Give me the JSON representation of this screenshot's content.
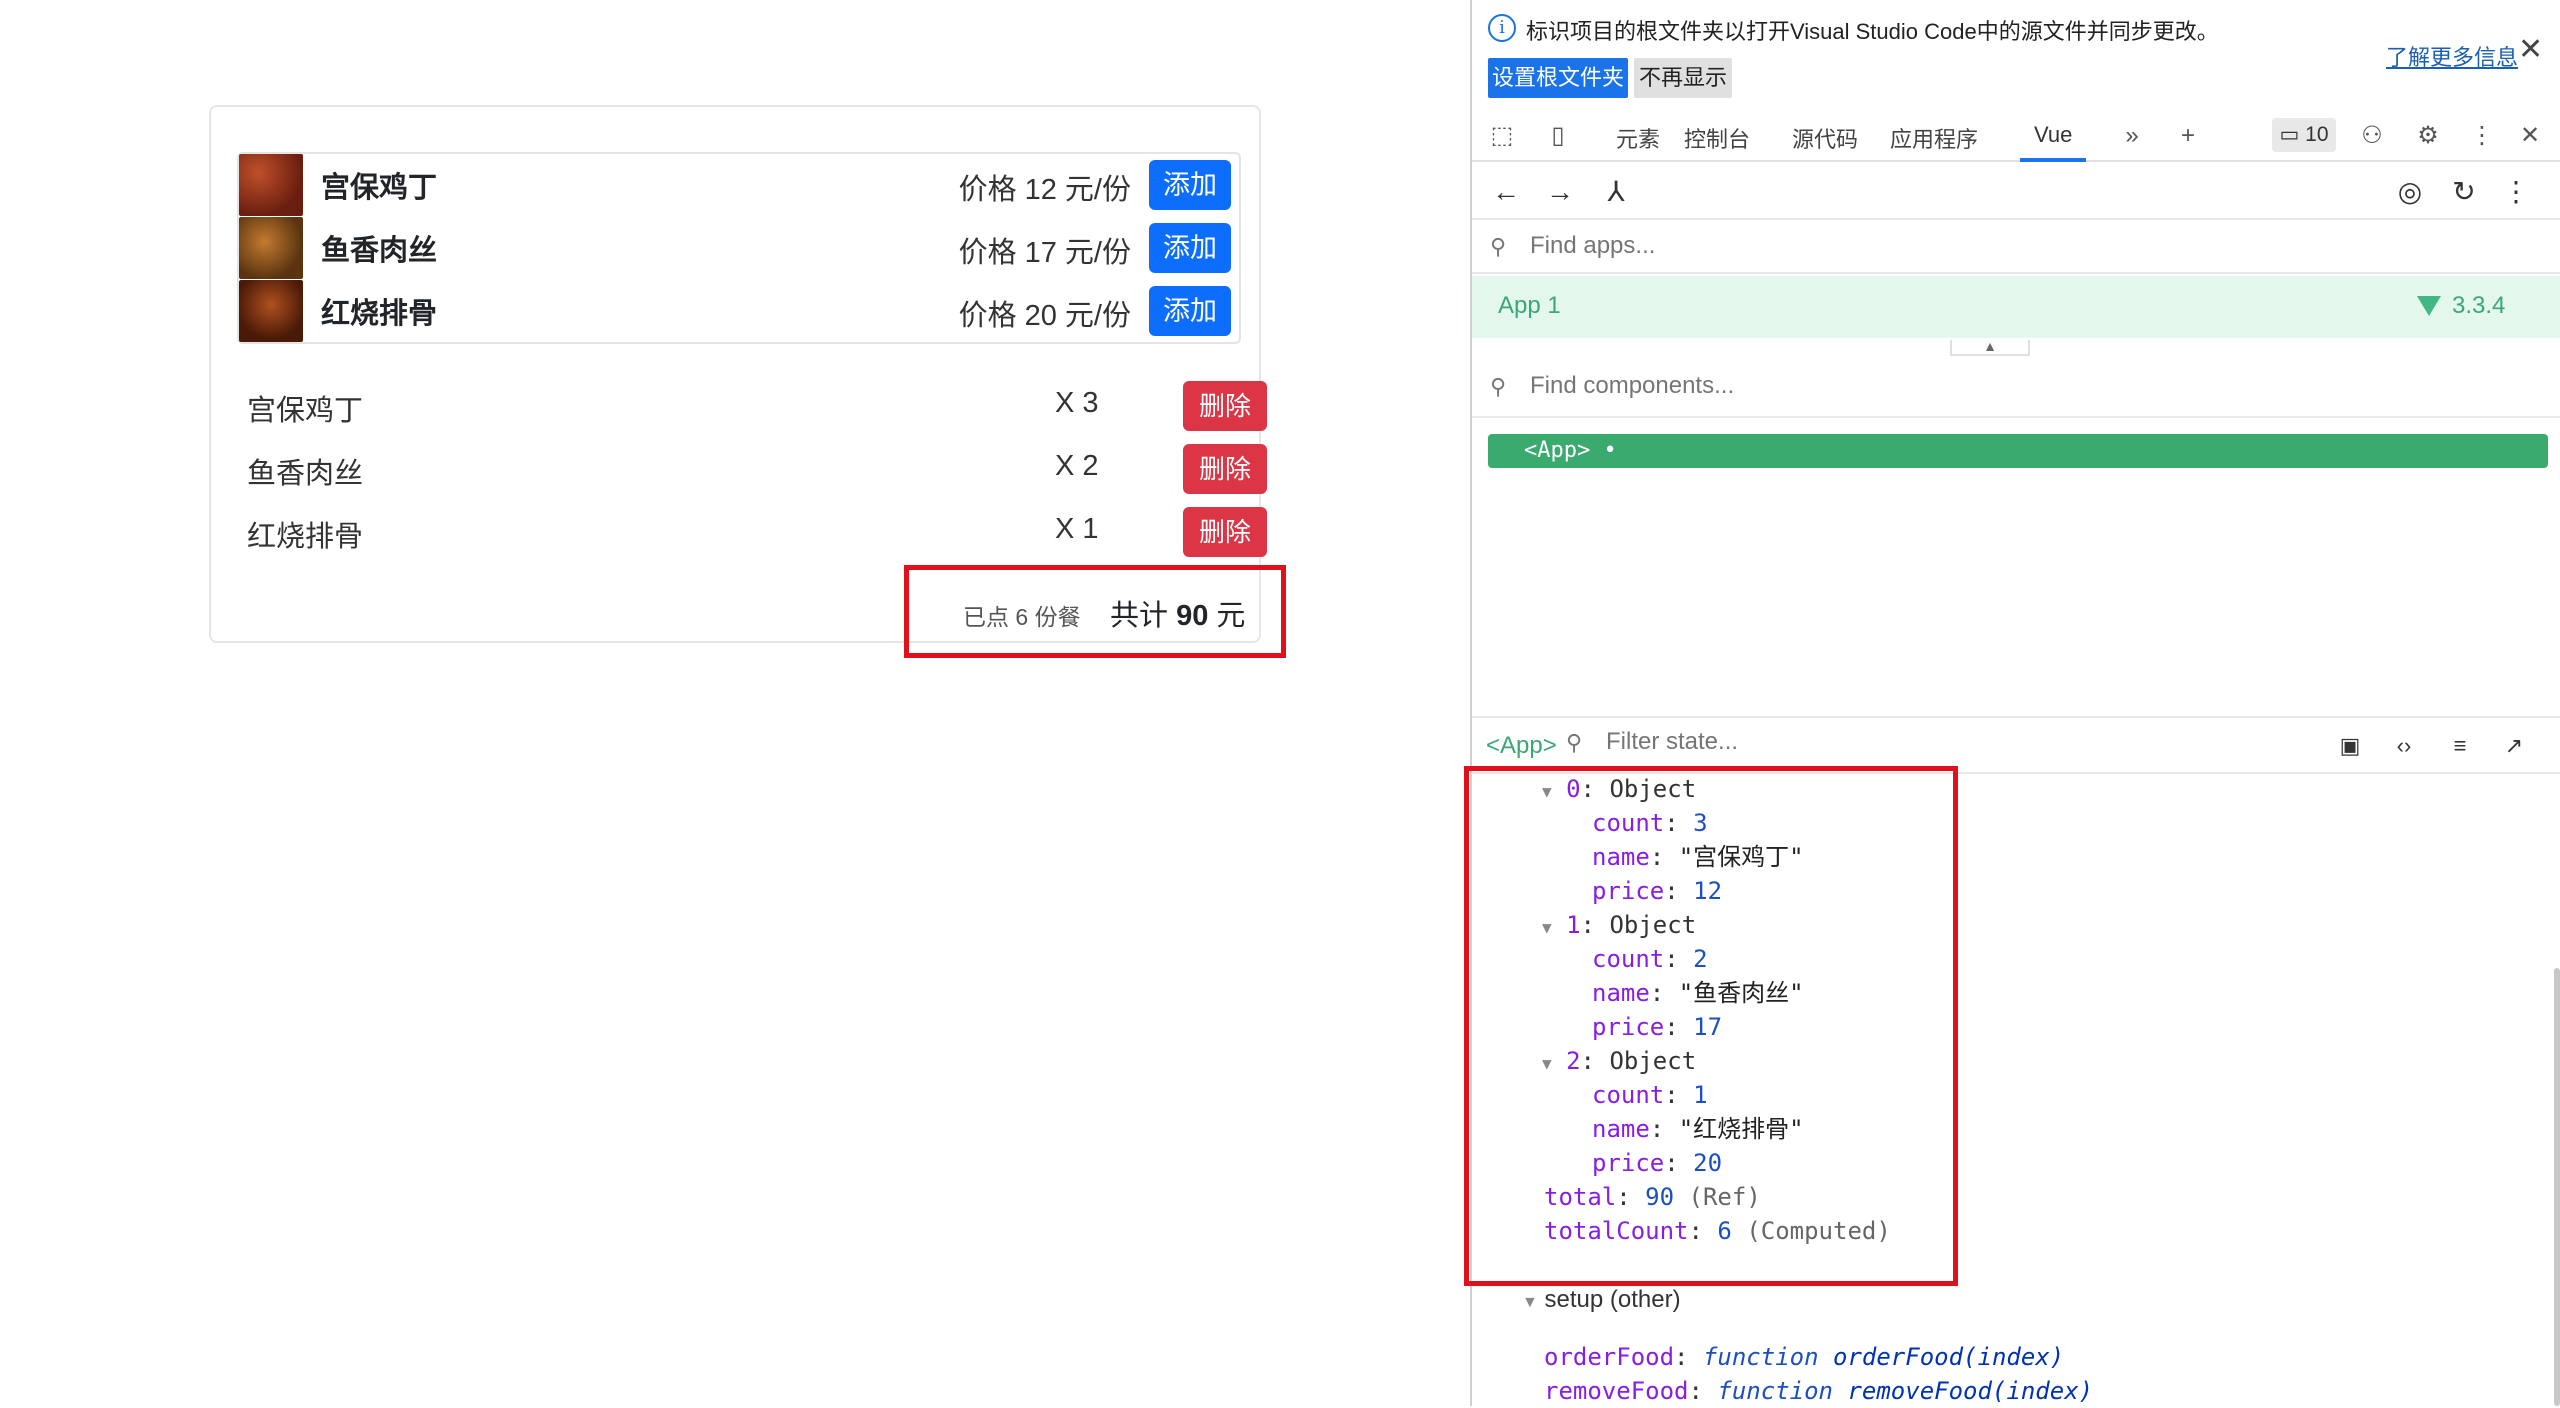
{
  "menu": [
    {
      "name": "宫保鸡丁",
      "price_text": "价格 12 元/份",
      "button": "添加",
      "img_color": "#8a2e1c"
    },
    {
      "name": "鱼香肉丝",
      "price_text": "价格 17 元/份",
      "button": "添加",
      "img_color": "#9a5a22"
    },
    {
      "name": "红烧排骨",
      "price_text": "价格 20 元/份",
      "button": "添加",
      "img_color": "#7a3516"
    }
  ],
  "orders": [
    {
      "name": "宫保鸡丁",
      "count_text": "X 3",
      "button": "删除"
    },
    {
      "name": "鱼香肉丝",
      "count_text": "X 2",
      "button": "删除"
    },
    {
      "name": "红烧排骨",
      "count_text": "X 1",
      "button": "删除"
    }
  ],
  "summary": {
    "ordered": "已点 6 份餐",
    "total_prefix": "共计",
    "total_value": "90",
    "total_unit": "元"
  },
  "devtools": {
    "info": {
      "text": "标识项目的根文件夹以打开Visual Studio Code中的源文件并同步更改。",
      "learn_more": "了解更多信息",
      "set_root": "设置根文件夹",
      "dont_show": "不再显示"
    },
    "tabs": [
      "元素",
      "控制台",
      "源代码",
      "应用程序",
      "Vue"
    ],
    "issues_count": "10",
    "find_apps_placeholder": "Find apps...",
    "app_name": "App 1",
    "vue_version": "3.3.4",
    "find_components_placeholder": "Find components...",
    "selected_component": "<App>",
    "state_component": "<App>",
    "filter_state_placeholder": "Filter state...",
    "state": {
      "objects": [
        {
          "index": "0",
          "label": "Object",
          "count": "3",
          "name": "\"宫保鸡丁\"",
          "price": "12"
        },
        {
          "index": "1",
          "label": "Object",
          "count": "2",
          "name": "\"鱼香肉丝\"",
          "price": "17"
        },
        {
          "index": "2",
          "label": "Object",
          "count": "1",
          "name": "\"红烧排骨\"",
          "price": "20"
        }
      ],
      "total": {
        "key": "total",
        "value": "90",
        "kind": "(Ref)"
      },
      "totalCount": {
        "key": "totalCount",
        "value": "6",
        "kind": "(Computed)"
      },
      "setup_label": "setup (other)",
      "functions": [
        {
          "key": "orderFood",
          "kw": "function",
          "sig": "orderFood(index)"
        },
        {
          "key": "removeFood",
          "kw": "function",
          "sig": "removeFood(index)"
        }
      ]
    }
  },
  "colors": {
    "primary": "#0d6efd",
    "danger": "#dc3545",
    "vue_green": "#41b883",
    "highlight": "#e0101c"
  }
}
